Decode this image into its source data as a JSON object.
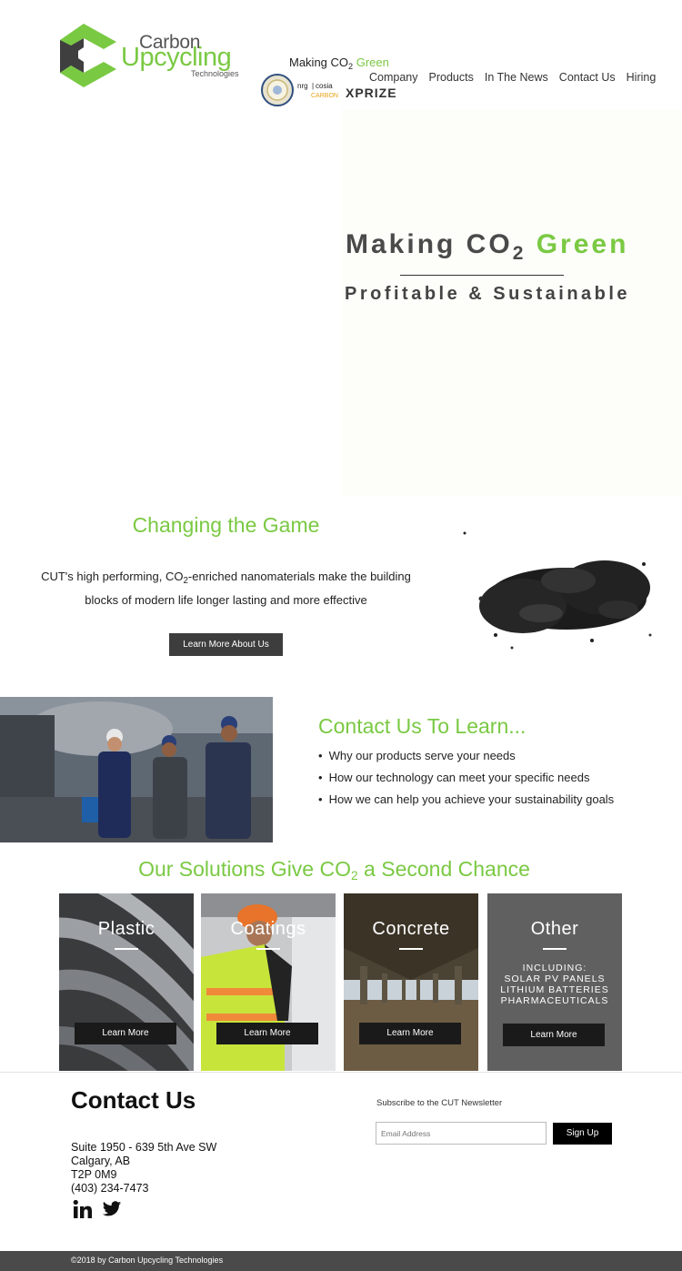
{
  "header": {
    "logo_word1": "Carbon",
    "logo_word2": "Upcycling",
    "logo_word3": "Technologies",
    "tagline_pre": "Making CO",
    "tagline_sub": "2",
    "tagline_green": " Green",
    "badge_text_nrg": "nrg",
    "badge_text_cosia": "cosia",
    "badge_text_carbon": "CARBON",
    "badge_text_xprize": "XPRIZE"
  },
  "nav": {
    "items": [
      "Company",
      "Products",
      "In The News",
      "Contact Us",
      "Hiring"
    ]
  },
  "hero": {
    "title_pre": "Making CO",
    "title_sub": "2",
    "title_green": "Green",
    "subtitle": "Profitable & Sustainable"
  },
  "game": {
    "title": "Changing the Game",
    "text_pre": "CUT's high performing, CO",
    "text_sub": "2",
    "text_post": "-enriched nanomaterials make the building blocks of modern life longer lasting and more effective",
    "button": "Learn More About Us"
  },
  "learn": {
    "title": "Contact Us To Learn...",
    "items": [
      "Why our products serve your needs",
      "How our technology can meet your specific needs",
      "How we can help you achieve your sustainability goals"
    ]
  },
  "solutions": {
    "title_pre": "Our Solutions Give CO",
    "title_sub": "2",
    "title_post": " a Second Chance",
    "cards": [
      {
        "label": "Plastic",
        "button": "Learn More"
      },
      {
        "label": "Coatings",
        "button": "Learn More"
      },
      {
        "label": "Concrete",
        "button": "Learn More"
      },
      {
        "label": "Other",
        "button": "Learn More",
        "including": [
          "INCLUDING:",
          "SOLAR PV PANELS",
          "LITHIUM BATTERIES",
          "PHARMACEUTICALS"
        ]
      }
    ]
  },
  "footer": {
    "contact_title": "Contact Us",
    "address": [
      "Suite 1950 - 639 5th Ave SW",
      "Calgary, AB",
      "T2P 0M9",
      "(403) 234-7473"
    ],
    "newsletter_label": "Subscribe to the CUT Newsletter",
    "email_placeholder": "Email Address",
    "signup": "Sign Up",
    "copyright": "©2018 by Carbon Upcycling Technologies",
    "social_icons": [
      "linkedin-icon",
      "twitter-icon"
    ]
  },
  "colors": {
    "brand_green": "#7ac943",
    "dark_gray": "#4a4a4a",
    "button_dark": "#3d3d3d"
  }
}
